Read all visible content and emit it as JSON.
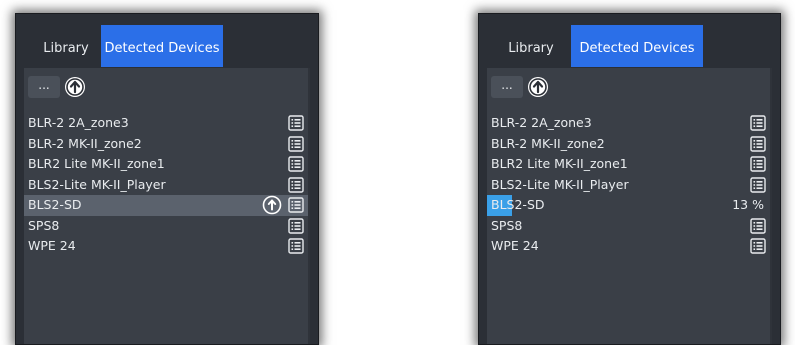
{
  "left_panel": {
    "tabs": [
      {
        "label": "Library"
      },
      {
        "label": "Detected Devices"
      }
    ],
    "toolbar": {
      "more_label": "..."
    },
    "devices": [
      {
        "name": "BLR-2 2A_zone3"
      },
      {
        "name": "BLR-2 MK-II_zone2"
      },
      {
        "name": "BLR2 Lite MK-II_zone1"
      },
      {
        "name": "BLS2-Lite MK-II_Player"
      },
      {
        "name": "BLS2-SD"
      },
      {
        "name": "SPS8"
      },
      {
        "name": "WPE 24"
      }
    ],
    "selected_index": 4
  },
  "right_panel": {
    "tabs": [
      {
        "label": "Library"
      },
      {
        "label": "Detected Devices"
      }
    ],
    "toolbar": {
      "more_label": "..."
    },
    "devices": [
      {
        "name": "BLR-2 2A_zone3"
      },
      {
        "name": "BLR-2 MK-II_zone2"
      },
      {
        "name": "BLR2 Lite MK-II_zone1"
      },
      {
        "name": "BLS2-Lite MK-II_Player"
      },
      {
        "name": "BLS2-SD"
      },
      {
        "name": "SPS8"
      },
      {
        "name": "WPE 24"
      }
    ],
    "progress": {
      "device_index": 4,
      "percent": 13,
      "text": "13 %"
    }
  },
  "colors": {
    "panel_bg": "#2b2f36",
    "list_bg": "#3a3f47",
    "active_tab": "#2b6fe8",
    "selected_row": "#5b626d",
    "progress_fill": "#3aa0e8",
    "text": "#e9ecef"
  },
  "icons": {
    "upload": "upload-circle-icon",
    "list": "list-icon"
  }
}
